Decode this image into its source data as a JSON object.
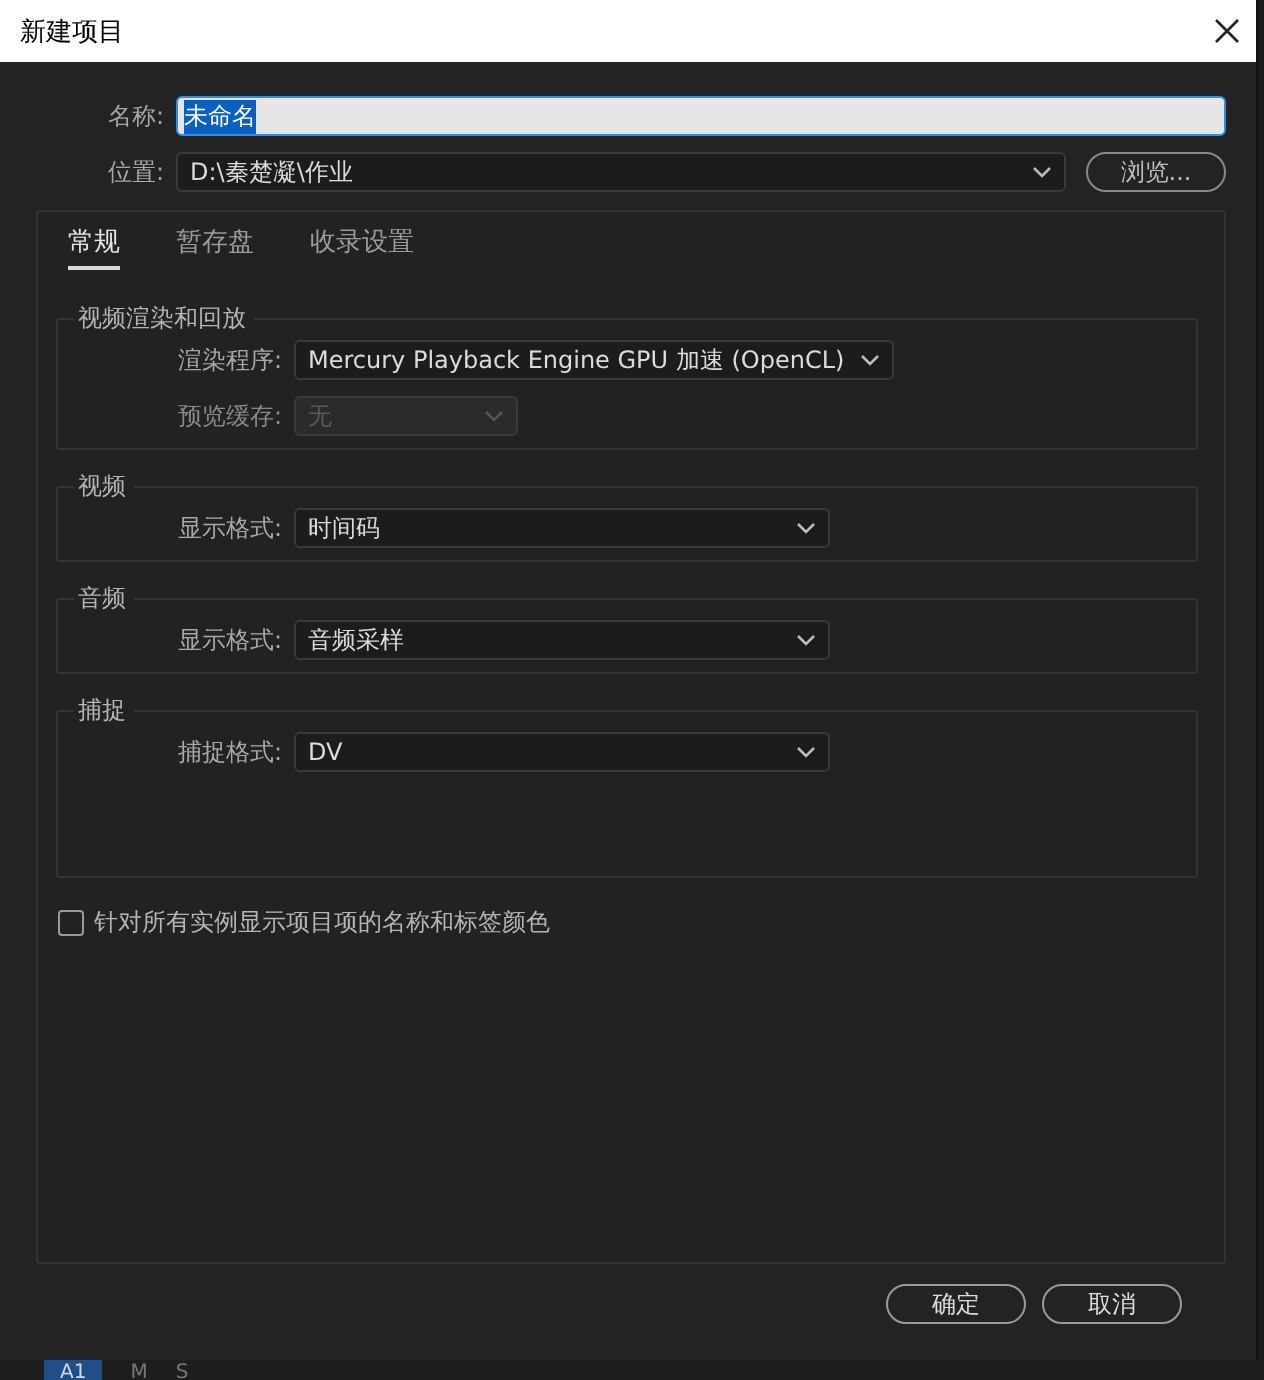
{
  "window": {
    "title": "新建项目"
  },
  "name_field": {
    "label": "名称:",
    "value": "未命名",
    "text_selected": true
  },
  "location_field": {
    "label": "位置:",
    "value": "D:\\秦楚凝\\作业"
  },
  "browse_button": "浏览...",
  "tabs": [
    {
      "label": "常规",
      "selected": true
    },
    {
      "label": "暂存盘",
      "selected": false
    },
    {
      "label": "收录设置",
      "selected": false
    }
  ],
  "groups": [
    {
      "title": "视频渲染和回放",
      "fields": [
        {
          "label": "渲染程序:",
          "value": "Mercury Playback Engine GPU 加速 (OpenCL)",
          "disabled": false
        },
        {
          "label": "预览缓存:",
          "value": "无",
          "disabled": true
        }
      ]
    },
    {
      "title": "视频",
      "fields": [
        {
          "label": "显示格式:",
          "value": "时间码",
          "disabled": false
        }
      ]
    },
    {
      "title": "音频",
      "fields": [
        {
          "label": "显示格式:",
          "value": "音频采样",
          "disabled": false
        }
      ]
    },
    {
      "title": "捕捉",
      "fields": [
        {
          "label": "捕捉格式:",
          "value": "DV",
          "disabled": false
        }
      ],
      "tall": true
    }
  ],
  "checkbox": {
    "label": "针对所有实例显示项目项的名称和标签颜色",
    "checked": false
  },
  "buttons": [
    "确定",
    "取消"
  ],
  "background_track": {
    "track": "A1",
    "mute": "M",
    "solo": "S"
  }
}
